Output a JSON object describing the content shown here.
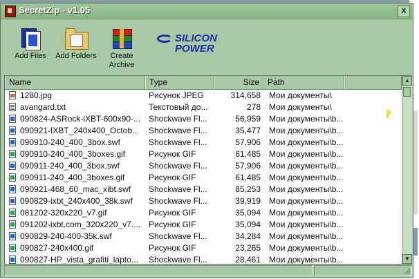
{
  "window": {
    "title": "SecretZip - v1.05",
    "close_label": "X"
  },
  "toolbar": {
    "add_files": "Add Files",
    "add_folders": "Add Folders",
    "create_archive": [
      "Create",
      "Archive"
    ]
  },
  "brand": {
    "line1": "SILICON",
    "line2": "POWER"
  },
  "columns": {
    "name": "Name",
    "type": "Type",
    "size": "Size",
    "path": "Path"
  },
  "files": [
    {
      "icon": "jpg",
      "name": "1280.jpg",
      "type": "Рисунок JPEG",
      "size": "314,658",
      "path": "Мои документы\\"
    },
    {
      "icon": "txt",
      "name": "avangard.txt",
      "type": "Текстовый до...",
      "size": "278",
      "path": "Мои документы\\"
    },
    {
      "icon": "swf",
      "name": "090824-ASRock-iXBT-600x90-...",
      "type": "Shockwave Fl...",
      "size": "56,959",
      "path": "Мои документы\\b..."
    },
    {
      "icon": "swf",
      "name": "090921-IXBT_240x400_Octob...",
      "type": "Shockwave Fl...",
      "size": "35,477",
      "path": "Мои документы\\b..."
    },
    {
      "icon": "swf",
      "name": "090910-240_400_3box.swf",
      "type": "Shockwave Fl...",
      "size": "57,906",
      "path": "Мои документы\\b..."
    },
    {
      "icon": "gif",
      "name": "090910-240_400_3boxes.gif",
      "type": "Рисунок GIF",
      "size": "61,485",
      "path": "Мои документы\\b..."
    },
    {
      "icon": "swf",
      "name": "090911-240_400_3box.swf",
      "type": "Shockwave Fl...",
      "size": "57,906",
      "path": "Мои документы\\b..."
    },
    {
      "icon": "gif",
      "name": "090911-240_400_3boxes.gif",
      "type": "Рисунок GIF",
      "size": "61,485",
      "path": "Мои документы\\b..."
    },
    {
      "icon": "swf",
      "name": "090921-468_60_mac_xibt.swf",
      "type": "Shockwave Fl...",
      "size": "85,253",
      "path": "Мои документы\\b..."
    },
    {
      "icon": "swf",
      "name": "090829-ixbt_240x400_38k.swf",
      "type": "Shockwave Fl...",
      "size": "39,919",
      "path": "Мои документы\\b..."
    },
    {
      "icon": "gif",
      "name": "081202-320x220_v7.gif",
      "type": "Рисунок GIF",
      "size": "35,094",
      "path": "Мои документы\\b..."
    },
    {
      "icon": "gif",
      "name": "091202-ixbt.com_320x220_v7....",
      "type": "Рисунок GIF",
      "size": "35,094",
      "path": "Мои документы\\b..."
    },
    {
      "icon": "swf",
      "name": "090829-240-400-35k.swf",
      "type": "Shockwave Fl...",
      "size": "34,284",
      "path": "Мои документы\\b..."
    },
    {
      "icon": "gif",
      "name": "090827-240x400.gif",
      "type": "Рисунок GIF",
      "size": "23,265",
      "path": "Мои документы\\b..."
    },
    {
      "icon": "swf",
      "name": "090827-HP_vista_grafiti_lapto...",
      "type": "Shockwave Fl...",
      "size": "28,461",
      "path": "Мои документы\\b..."
    }
  ],
  "colors": {
    "window_bg": "#a9c8a5",
    "brand": "#1b2da8",
    "list_bg": "#ffffff"
  }
}
